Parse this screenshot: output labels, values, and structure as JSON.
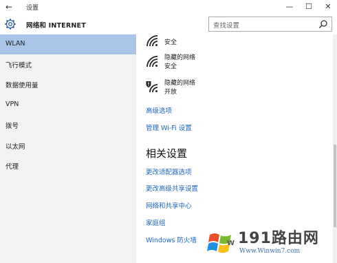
{
  "window": {
    "back_glyph": "←",
    "title": "设置",
    "minimize_glyph": "—",
    "maximize_glyph": "☐",
    "close_glyph": "✕"
  },
  "header": {
    "category_title": "网络和 INTERNET",
    "icon": "gear-icon"
  },
  "search": {
    "placeholder": "查找设置",
    "icon": "search-icon"
  },
  "sidebar": {
    "items": [
      {
        "label": "WLAN",
        "active": true
      },
      {
        "label": "飞行模式"
      },
      {
        "label": "数据使用量"
      },
      {
        "label": "VPN"
      },
      {
        "label": "拨号"
      },
      {
        "label": "以太网"
      },
      {
        "label": "代理"
      }
    ]
  },
  "networks": [
    {
      "name": "安全",
      "status": "",
      "icon": "wifi-icon"
    },
    {
      "name": "隐藏的网络",
      "status": "安全",
      "icon": "wifi-icon"
    },
    {
      "name": "隐藏的网络",
      "status": "开放",
      "icon": "wifi-warning-icon"
    }
  ],
  "links": {
    "advanced_options": "高级选项",
    "manage_wifi": "管理 Wi-Fi 设置"
  },
  "related": {
    "title": "相关设置",
    "links": [
      "更改适配器选项",
      "更改高级共享设置",
      "网络和共享中心",
      "家庭组",
      "Windows 防火墙"
    ]
  },
  "watermark": {
    "main": "191路由网",
    "sub": "Www.Winwin7.com",
    "letter": "W"
  },
  "colors": {
    "accent_link": "#1a66c4",
    "active_nav": "#a9c4e6",
    "sidebar_bg": "#f2f2f2"
  }
}
